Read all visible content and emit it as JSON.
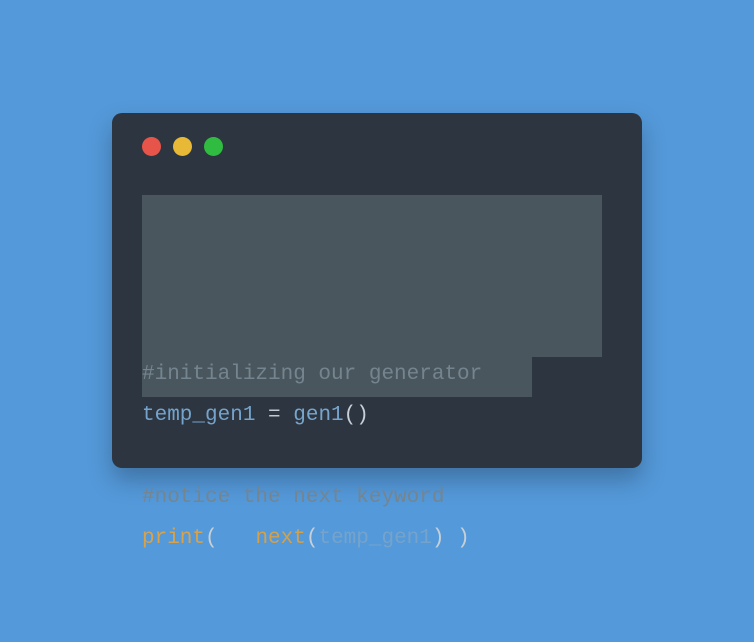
{
  "code": {
    "line1_comment": "#initializing our generator",
    "line2_var": "temp_gen1",
    "line2_eq": " = ",
    "line2_func": "gen1",
    "line2_paren": "()",
    "line3": "",
    "line4_comment": "#notice the next keyword",
    "line5_builtin": "print",
    "line5_open": "(   ",
    "line5_method": "next",
    "line5_mopen": "(",
    "line5_arg": "temp_gen1",
    "line5_mclose": ")",
    "line5_close": " )"
  }
}
